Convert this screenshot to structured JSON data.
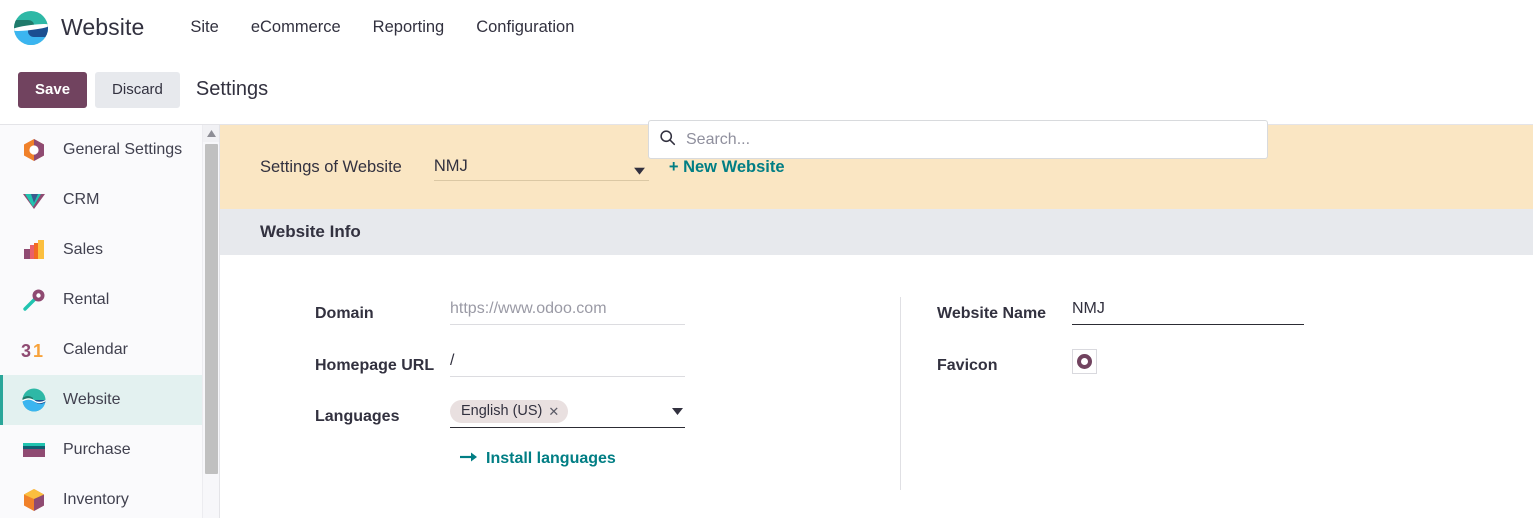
{
  "navbar": {
    "app_logo_icon": "website-app-logo-icon",
    "brand": "Website",
    "menu": [
      {
        "label": "Site"
      },
      {
        "label": "eCommerce"
      },
      {
        "label": "Reporting"
      },
      {
        "label": "Configuration"
      }
    ]
  },
  "control_bar": {
    "save_label": "Save",
    "discard_label": "Discard",
    "page_title": "Settings",
    "search": {
      "icon": "search-icon",
      "placeholder": "Search...",
      "value": ""
    }
  },
  "sidebar": {
    "items": [
      {
        "label": "General Settings",
        "icon": "settings-hexagon-icon",
        "active": false
      },
      {
        "label": "CRM",
        "icon": "crm-diamond-icon",
        "active": false
      },
      {
        "label": "Sales",
        "icon": "sales-barchart-icon",
        "active": false
      },
      {
        "label": "Rental",
        "icon": "rental-key-icon",
        "active": false
      },
      {
        "label": "Calendar",
        "icon": "calendar-31-icon",
        "active": false
      },
      {
        "label": "Website",
        "icon": "website-globe-icon",
        "active": true
      },
      {
        "label": "Purchase",
        "icon": "purchase-card-icon",
        "active": false
      },
      {
        "label": "Inventory",
        "icon": "inventory-box-icon",
        "active": false
      }
    ],
    "scrollbar_up_icon": "scroll-up-arrow-icon"
  },
  "settings_header": {
    "label": "Settings of Website",
    "website_selected": "NMJ",
    "website_options": [
      "NMJ"
    ],
    "caret_icon": "chevron-down-icon",
    "new_website_label": "+ New Website"
  },
  "section": {
    "title": "Website Info"
  },
  "form": {
    "left": {
      "domain": {
        "label": "Domain",
        "value": "",
        "placeholder": "https://www.odoo.com"
      },
      "homepage_url": {
        "label": "Homepage URL",
        "value": "/",
        "placeholder": ""
      },
      "languages": {
        "label": "Languages",
        "tags": [
          {
            "label": "English (US)",
            "remove_icon": "close-x-icon"
          }
        ],
        "caret_icon": "chevron-down-icon"
      },
      "install_languages": {
        "label": "Install languages",
        "icon": "arrow-right-icon"
      }
    },
    "right": {
      "website_name": {
        "label": "Website Name",
        "value": "NMJ",
        "placeholder": ""
      },
      "favicon": {
        "label": "Favicon",
        "icon": "favicon-ring-icon"
      }
    }
  },
  "colors": {
    "brand_purple": "#71435f",
    "accent_teal": "#017e84",
    "header_cream": "#fae6c3",
    "section_gray": "#e7e9ed",
    "active_item": "#e3f1f0"
  }
}
